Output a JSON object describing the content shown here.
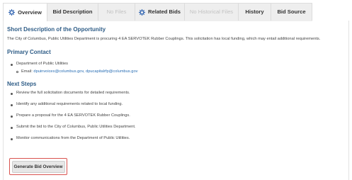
{
  "tabs": [
    {
      "label": "Overview",
      "icon": "gear-icon",
      "state": "active"
    },
    {
      "label": "Bid Description",
      "state": "normal"
    },
    {
      "label": "No Files",
      "state": "disabled"
    },
    {
      "label": "Related Bids",
      "icon": "gear-icon",
      "state": "normal"
    },
    {
      "label": "No Historical Files",
      "state": "disabled"
    },
    {
      "label": "History",
      "state": "normal"
    },
    {
      "label": "Bid Source",
      "state": "normal"
    }
  ],
  "short_description": {
    "heading": "Short Description of the Opportunity",
    "text": "The City of Columbus, Public Utilities Department is procuring 4 EA SERVOTEK Rubber Couplings. This solicitation has local funding, which may entail additional requirements."
  },
  "primary_contact": {
    "heading": "Primary Contact",
    "department": "Department of Public Utilities",
    "email_label": "Email:",
    "emails": "dpuinvoices@columbus.gov, dpucapitalrfp@columbus.gov"
  },
  "next_steps": {
    "heading": "Next Steps",
    "items": [
      "Review the full solicitation documents for detailed requirements.",
      "Identify any additional requirements related to local funding.",
      "Prepare a proposal for the 4 EA SERVOTEK Rubber Couplings.",
      "Submit the bid to the City of Columbus, Public Utilities Department.",
      "Monitor communications from the Department of Public Utilities."
    ]
  },
  "generate_button": {
    "label": "Generate Bid Overview"
  },
  "colors": {
    "accent": "#2f5d87",
    "link": "#2a6fb5",
    "highlight_border": "#d9534f"
  }
}
